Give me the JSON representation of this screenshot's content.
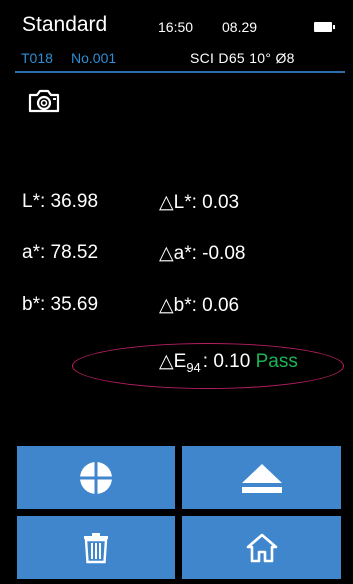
{
  "header": {
    "title": "Standard",
    "time": "16:50",
    "date": "08.29",
    "record_id": "T018",
    "sample_no": "No.001",
    "mode": "SCI  D65  10°  Ø8"
  },
  "icons": {
    "camera": "camera-icon",
    "battery": "battery-icon"
  },
  "measurements": {
    "L": "L*: 36.98",
    "a": "a*: 78.52",
    "b": "b*: 35.69",
    "dL": "L*: 0.03",
    "da": "a*: -0.08",
    "db": "b*: 0.06",
    "dE_label": "E",
    "dE_sub": "94",
    "dE_value": ": 0.10",
    "status": "Pass"
  },
  "buttons": {
    "target": "crosshair-target-icon",
    "eject": "eject-icon",
    "delete": "trash-icon",
    "home": "home-icon"
  },
  "colors": {
    "accent_blue": "#3f86cc",
    "pass_green": "#1db354",
    "highlight_ellipse": "#b51f62"
  }
}
